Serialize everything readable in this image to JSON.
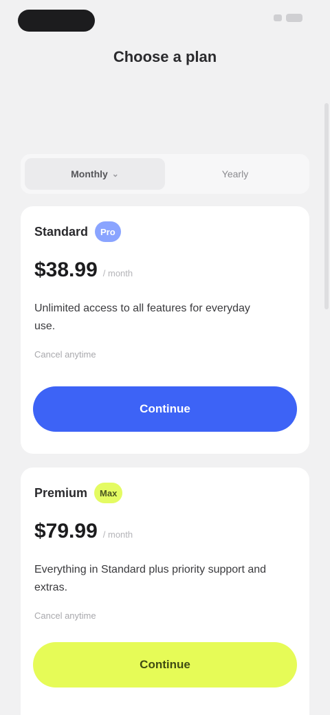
{
  "header": {
    "title": "Choose a plan"
  },
  "tabs": [
    {
      "label": "Monthly",
      "active": true
    },
    {
      "label": "Yearly",
      "active": false
    }
  ],
  "plans": [
    {
      "name": "Standard",
      "badge": "Pro",
      "price": "$38.99",
      "period": "/ month",
      "description": "Unlimited access to all features for everyday use.",
      "note": "Cancel anytime",
      "button_label": "Continue",
      "accent": "#3d63f6"
    },
    {
      "name": "Premium",
      "badge": "Max",
      "price": "$79.99",
      "period": "/ month",
      "description": "Everything in Standard plus priority support and extras.",
      "note": "Cancel anytime",
      "button_label": "Continue",
      "accent": "#e6fb57"
    }
  ],
  "icons": {
    "tab_chevron": "chevron-down-icon",
    "status": [
      "signal-icon",
      "battery-icon"
    ]
  }
}
